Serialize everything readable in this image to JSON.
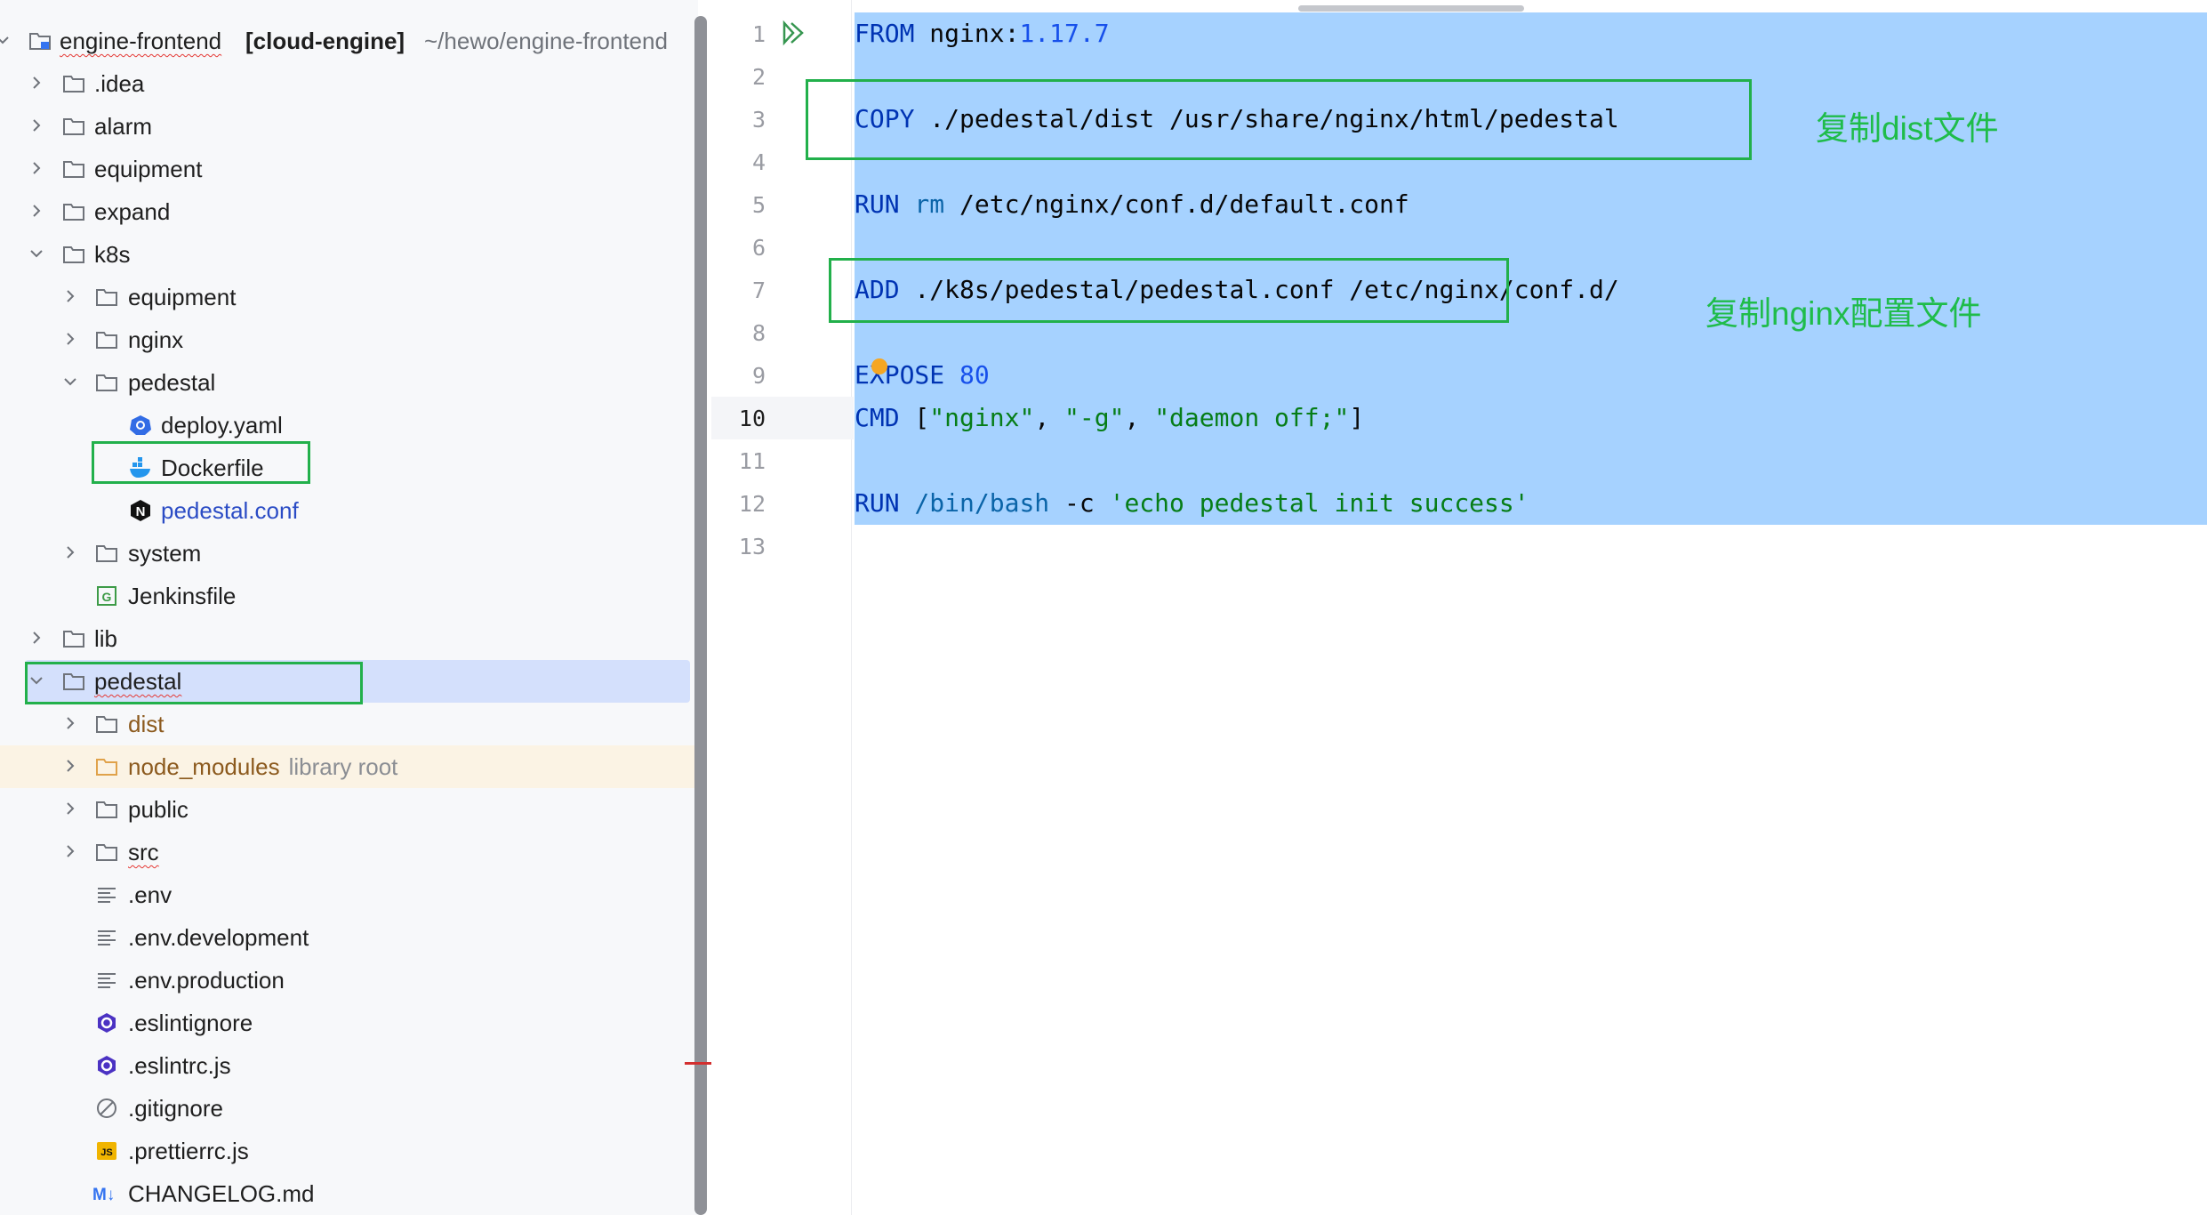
{
  "tree": {
    "root": {
      "name": "engine-frontend",
      "module": "[cloud-engine]",
      "path": "~/hewo/engine-frontend"
    },
    "items": [
      {
        "label": ".idea"
      },
      {
        "label": "alarm"
      },
      {
        "label": "equipment"
      },
      {
        "label": "expand"
      },
      {
        "label": "k8s"
      },
      {
        "label": "equipment"
      },
      {
        "label": "nginx"
      },
      {
        "label": "pedestal"
      },
      {
        "label": "deploy.yaml"
      },
      {
        "label": "Dockerfile"
      },
      {
        "label": "pedestal.conf"
      },
      {
        "label": "system"
      },
      {
        "label": "Jenkinsfile"
      },
      {
        "label": "lib"
      },
      {
        "label": "pedestal"
      },
      {
        "label": "dist"
      },
      {
        "label": "node_modules",
        "suffix": "library root"
      },
      {
        "label": "public"
      },
      {
        "label": "src"
      },
      {
        "label": ".env"
      },
      {
        "label": ".env.development"
      },
      {
        "label": ".env.production"
      },
      {
        "label": ".eslintignore"
      },
      {
        "label": ".eslintrc.js"
      },
      {
        "label": ".gitignore"
      },
      {
        "label": ".prettierrc.js"
      },
      {
        "label": "CHANGELOG.md"
      }
    ]
  },
  "editor": {
    "line_numbers": [
      "1",
      "2",
      "3",
      "4",
      "5",
      "6",
      "7",
      "8",
      "9",
      "10",
      "11",
      "12",
      "13"
    ],
    "current_line": "10",
    "code": {
      "l1": {
        "kw": "FROM",
        "img": " nginx:",
        "ver": "1.17.7"
      },
      "l3": {
        "kw": "COPY",
        "rest": " ./pedestal/dist /usr/share/nginx/html/pedestal"
      },
      "l5": {
        "kw": "RUN",
        "cmd": " rm",
        "rest": " /etc/nginx/conf.d/default.conf"
      },
      "l7": {
        "kw": "ADD",
        "rest": " ./k8s/pedestal/pedestal.conf /etc/nginx/conf.d/"
      },
      "l9": {
        "kw": "EXPOSE",
        "num": " 80"
      },
      "l10": {
        "kw": "CMD",
        "p1": " [",
        "s1": "\"nginx\"",
        "c1": ", ",
        "s2": "\"-g\"",
        "c2": ", ",
        "s3": "\"daemon off;\"",
        "p2": "]"
      },
      "l12": {
        "kw": "RUN",
        "cmd": " /bin/bash",
        "flag": " -c ",
        "str": "'echo pedestal init success'"
      }
    }
  },
  "annotations": {
    "copy_note": "复制dist文件",
    "add_note": "复制nginx配置文件"
  },
  "colors": {
    "selection": "#a6d2ff",
    "annotation_green": "#22b04b",
    "keyword": "#0033b3",
    "string": "#067d17"
  }
}
